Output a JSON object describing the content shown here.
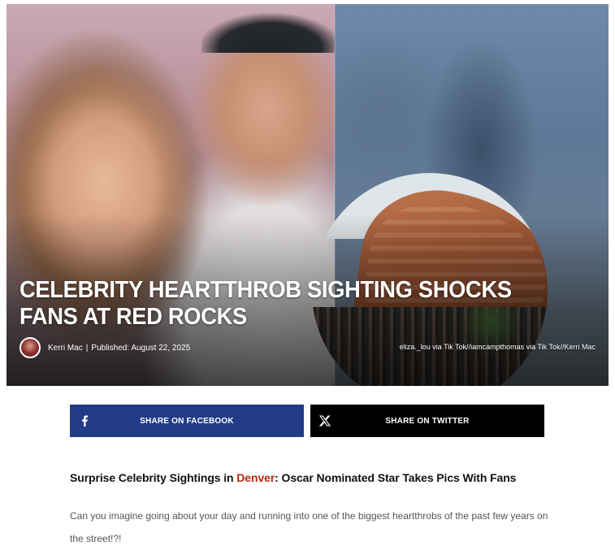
{
  "hero": {
    "title": "CELEBRITY HEARTTHROB SIGHTING SHOCKS FANS AT RED ROCKS",
    "author": "Kerri Mac",
    "byline_separator": "|",
    "published": "Published: August 22, 2025",
    "photo_credit": "eliza._lou via Tik Tok//iamcampthomas via Tik Tok//Kerri Mac"
  },
  "share": {
    "facebook_label": "SHARE ON FACEBOOK",
    "twitter_label": "SHARE ON TWITTER",
    "facebook_color": "#213b86",
    "twitter_color": "#000000"
  },
  "article": {
    "subhead_prefix": "Surprise Celebrity Sightings in ",
    "subhead_link": "Denver",
    "subhead_suffix": ": Oscar Nominated Star Takes Pics With Fans",
    "link_color": "#b5290f",
    "paragraph": "Can you imagine going about your day and running into one of the biggest heartthrobs of the past few years on the street!?!"
  },
  "icons": {
    "facebook": "facebook-icon",
    "twitter": "x-twitter-icon"
  }
}
